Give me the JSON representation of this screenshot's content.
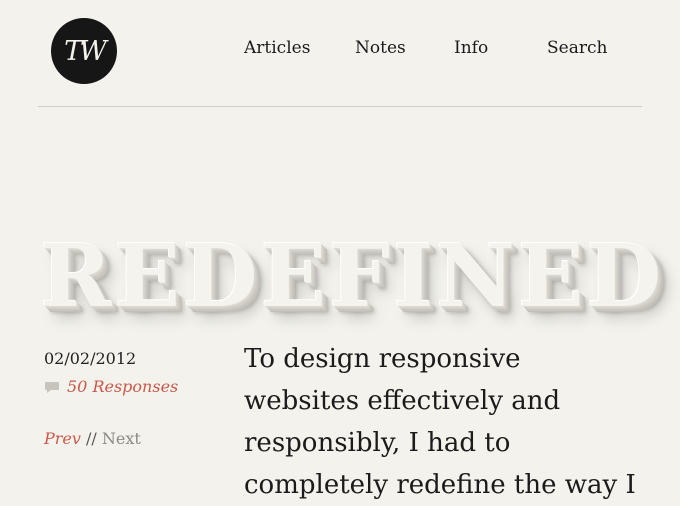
{
  "logo": {
    "monogram": "TW"
  },
  "nav": {
    "items": [
      {
        "label": "Articles"
      },
      {
        "label": "Notes"
      },
      {
        "label": "Info"
      },
      {
        "label": "Search"
      }
    ]
  },
  "headline": "REDEFINED",
  "post": {
    "date": "02/02/2012",
    "responses": "50 Responses",
    "pager": {
      "prev": "Prev",
      "separator": "//",
      "next": "Next"
    },
    "lines": [
      "To design responsive",
      "websites effectively and",
      "responsibly, I had to",
      "completely redefine the way I"
    ]
  },
  "colors": {
    "background": "#f3f2ec",
    "text": "#1b1b1b",
    "accent": "#c9594b",
    "muted": "#8c8a85",
    "logo_bg": "#161616"
  },
  "icons": {
    "comment": "comment-icon"
  }
}
